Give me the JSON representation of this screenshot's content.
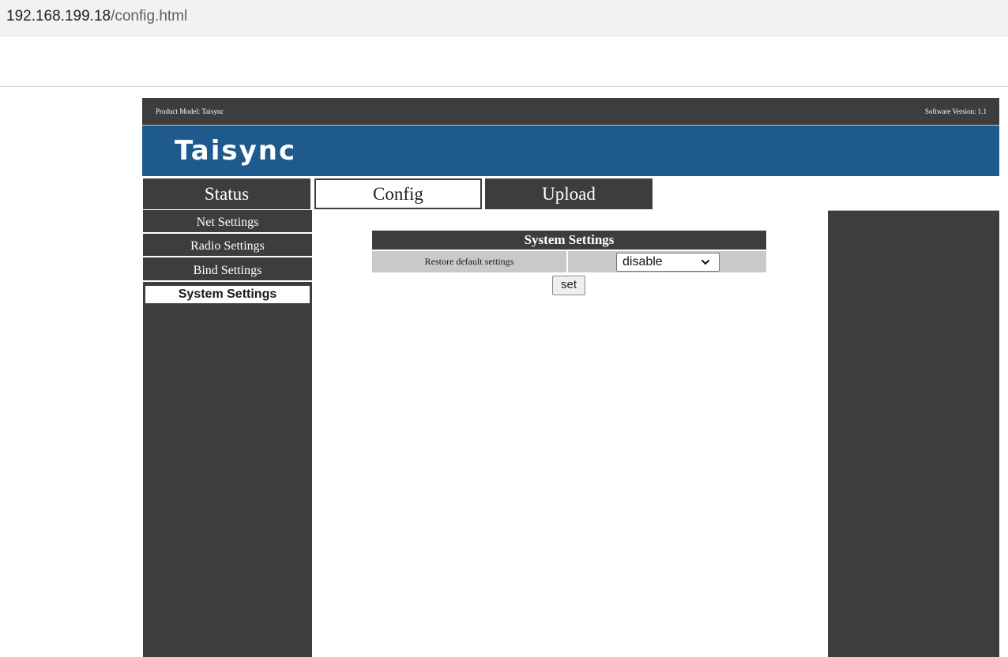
{
  "browser": {
    "url_host": "192.168.199.18",
    "url_path": "/config.html"
  },
  "header": {
    "product_model": "Product Model:  Taisync",
    "software_version": "Software Version:  1.1",
    "brand": "Taisync"
  },
  "tabs": [
    {
      "label": "Status",
      "active": false
    },
    {
      "label": "Config",
      "active": true
    },
    {
      "label": "Upload",
      "active": false
    }
  ],
  "sidebar": {
    "items": [
      {
        "label": "Net Settings",
        "active": false
      },
      {
        "label": "Radio Settings",
        "active": false
      },
      {
        "label": "Bind Settings",
        "active": false
      },
      {
        "label": "System Settings",
        "active": true
      }
    ]
  },
  "panel": {
    "title": "System Settings",
    "row_label": "Restore default settings",
    "select_value": "disable",
    "set_label": "set"
  },
  "colors": {
    "dark": "#3d3d3f",
    "banner": "#1f5a8e",
    "row_bg": "#c9c9c9"
  }
}
